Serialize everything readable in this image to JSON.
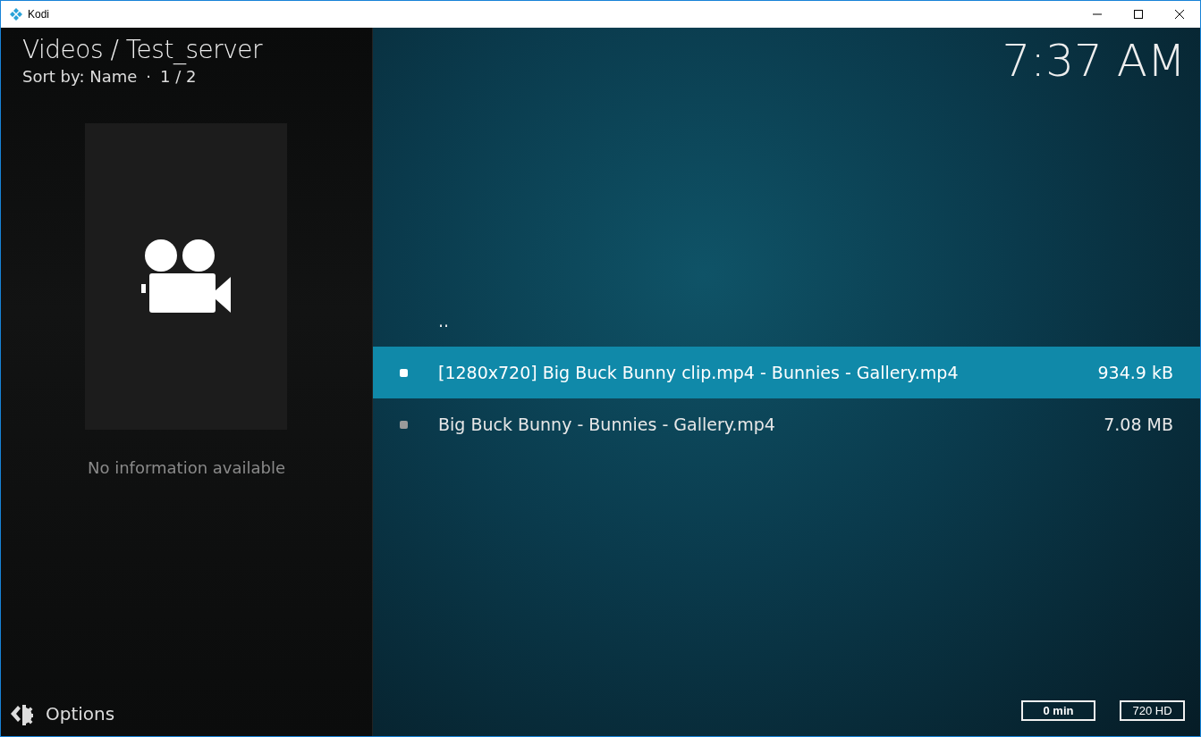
{
  "window": {
    "title": "Kodi"
  },
  "header": {
    "title": "Videos / Test_server",
    "sort": "Sort by: Name",
    "separator": "·",
    "page": "1 / 2"
  },
  "info": {
    "message": "No information available"
  },
  "options": {
    "label": "Options"
  },
  "clock": "7:37 AM",
  "items": [
    {
      "kind": "parent",
      "label": "..",
      "selected": false
    },
    {
      "kind": "file",
      "label": "[1280x720] Big Buck Bunny clip.mp4 - Bunnies - Gallery.mp4",
      "size": "934.9 kB",
      "selected": true
    },
    {
      "kind": "file",
      "label": "Big Buck Bunny - Bunnies - Gallery.mp4",
      "size": "7.08 MB",
      "selected": false
    }
  ],
  "badges": [
    "0 min",
    "720 HD"
  ]
}
